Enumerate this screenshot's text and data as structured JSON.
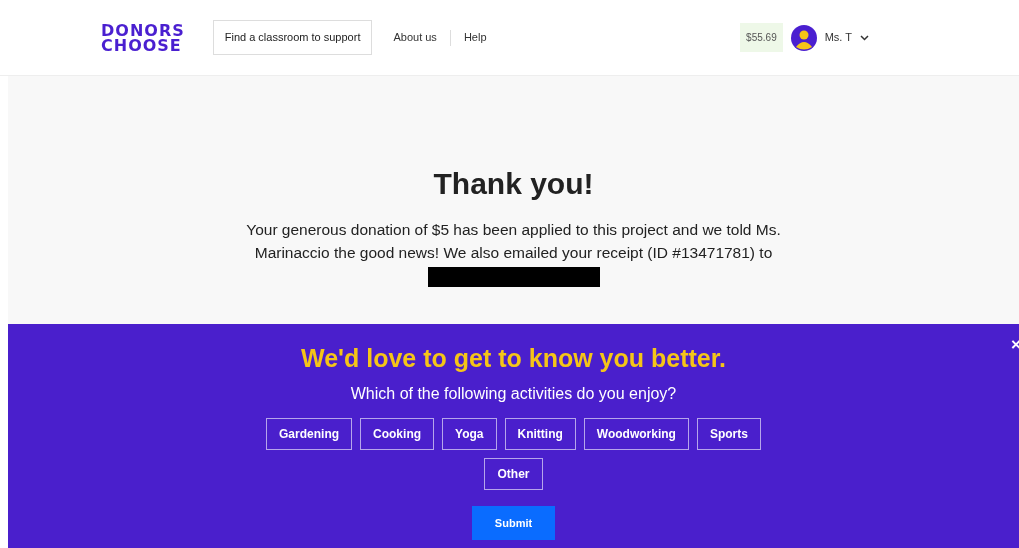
{
  "header": {
    "logo": [
      "DONORS",
      "CHOOSE"
    ],
    "search_button": "Find a classroom to support",
    "links": [
      "About us",
      "Help"
    ],
    "balance": "$55.69",
    "user": "Ms. T"
  },
  "thank_you": {
    "title": "Thank you!",
    "message": "Your generous donation of $5 has been applied to this project and we told Ms. Marinaccio the good news! We also emailed your receipt (ID #13471781) to"
  },
  "survey": {
    "close": "×",
    "title": "We'd love to get to know you better.",
    "question": "Which of the following activities do you enjoy?",
    "options": [
      {
        "label": "Gardening",
        "selected": false
      },
      {
        "label": "Cooking",
        "selected": false
      },
      {
        "label": "Yoga",
        "selected": false
      },
      {
        "label": "Knitting",
        "selected": false
      },
      {
        "label": "Woodworking",
        "selected": false
      },
      {
        "label": "Sports",
        "selected": false
      },
      {
        "label": "Other",
        "selected": false
      }
    ],
    "submit": "Submit"
  }
}
